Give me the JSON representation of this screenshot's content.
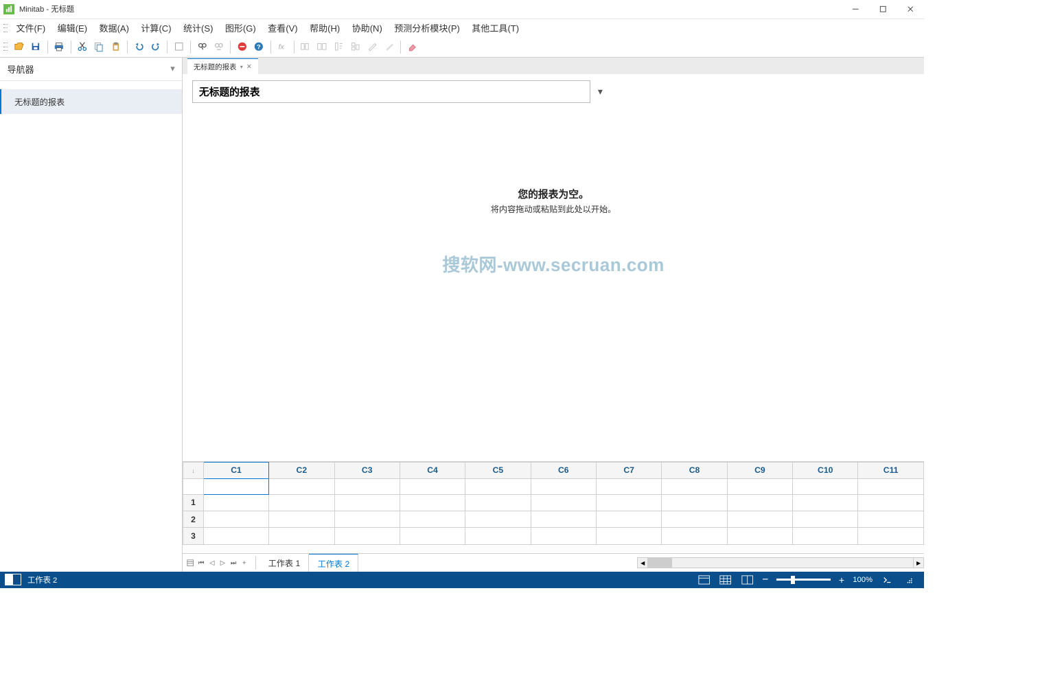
{
  "window": {
    "title": "Minitab - 无标题"
  },
  "menu": {
    "items": [
      "文件(F)",
      "编辑(E)",
      "数据(A)",
      "计算(C)",
      "统计(S)",
      "图形(G)",
      "查看(V)",
      "帮助(H)",
      "协助(N)",
      "预测分析模块(P)",
      "其他工具(T)"
    ]
  },
  "navigator": {
    "title": "导航器",
    "items": [
      "无标题的报表"
    ]
  },
  "document": {
    "tab_label": "无标题的报表",
    "report_title": "无标题的报表",
    "empty_heading": "您的报表为空。",
    "empty_sub": "将内容拖动或粘贴到此处以开始。",
    "watermark": "搜软网-www.secruan.com"
  },
  "worksheet": {
    "columns": [
      "C1",
      "C2",
      "C3",
      "C4",
      "C5",
      "C6",
      "C7",
      "C8",
      "C9",
      "C10",
      "C11"
    ],
    "rows": [
      "1",
      "2",
      "3"
    ],
    "tabs": [
      "工作表 1",
      "工作表 2"
    ],
    "active_tab_index": 1
  },
  "statusbar": {
    "sheet": "工作表 2",
    "zoom": "100%"
  },
  "icons": {
    "corner_arrow": "↓"
  }
}
